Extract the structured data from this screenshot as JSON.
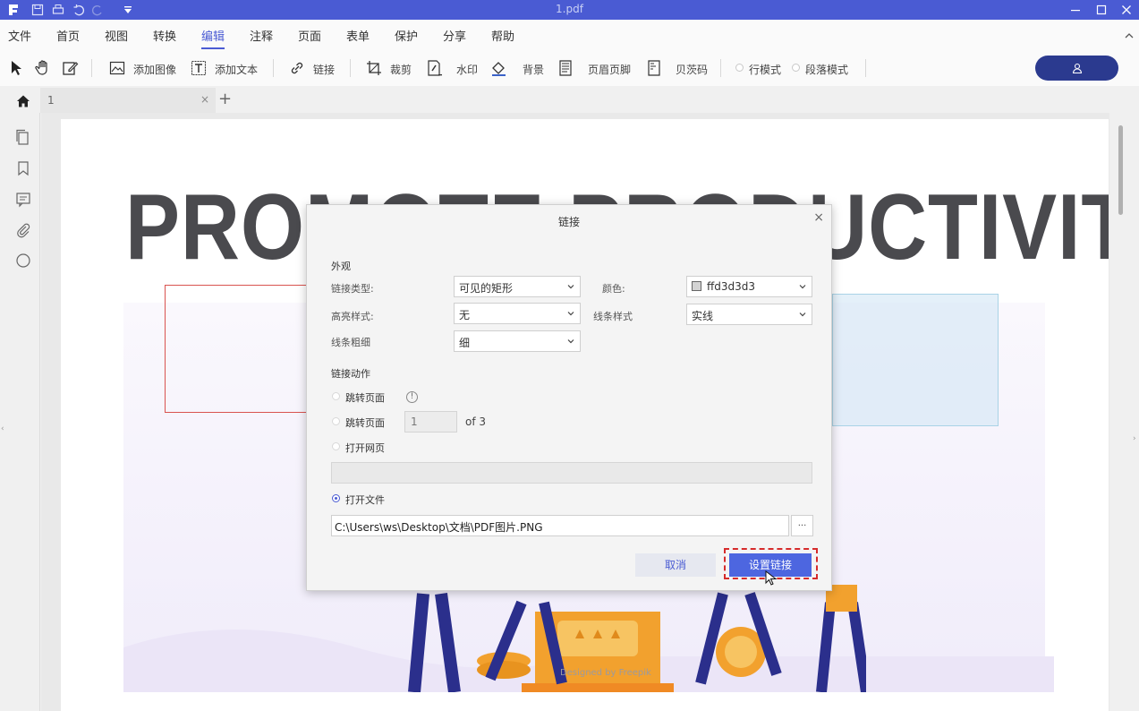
{
  "titlebar": {
    "title": "1.pdf"
  },
  "menu": {
    "items": [
      "文件",
      "首页",
      "视图",
      "转换",
      "编辑",
      "注释",
      "页面",
      "表单",
      "保护",
      "分享",
      "帮助"
    ],
    "active": "编辑"
  },
  "toolbar": {
    "add_image": "添加图像",
    "add_text": "添加文本",
    "link": "链接",
    "crop": "裁剪",
    "watermark": "水印",
    "background": "背景",
    "header_footer": "页眉页脚",
    "bates": "贝茨码",
    "line_mode": "行模式",
    "paragraph_mode": "段落模式"
  },
  "tabs": {
    "doc_tab_label": "1",
    "close": "×",
    "new": "+"
  },
  "page": {
    "hero_text": "PROMOTE PRODUCTIVITY",
    "credit": "Designed by Freepik"
  },
  "dialog": {
    "title": "链接",
    "close": "×",
    "appearance_heading": "外观",
    "link_type_label": "链接类型:",
    "link_type_value": "可见的矩形",
    "color_label": "颜色:",
    "color_value": "ffd3d3d3",
    "highlight_label": "高亮样式:",
    "highlight_value": "无",
    "line_style_label": "线条样式",
    "line_style_value": "实线",
    "line_width_label": "线条粗细",
    "line_width_value": "细",
    "action_heading": "链接动作",
    "goto_page_label": "跳转页面",
    "goto_page2_label": "跳转页面",
    "page_number": "1",
    "page_of": "of 3",
    "open_web_label": "打开网页",
    "open_file_label": "打开文件",
    "file_path": "C:\\Users\\ws\\Desktop\\文档\\PDF图片.PNG",
    "browse": "...",
    "cancel": "取消",
    "ok": "设置链接"
  },
  "colors": {
    "accent": "#4a5bd3",
    "titlebar": "#4a5bd3",
    "user_button": "#2b3a8f",
    "highlight": "#d62b2b"
  }
}
